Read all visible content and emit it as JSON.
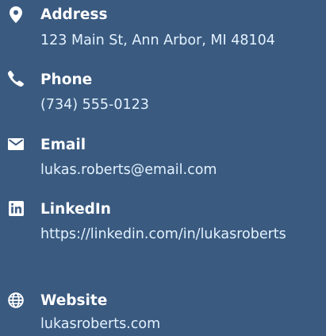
{
  "contacts": [
    {
      "label": "Address",
      "value": "123 Main St, Ann Arbor, MI 48104",
      "icon": "map-pin-icon"
    },
    {
      "label": "Phone",
      "value": "(734) 555-0123",
      "icon": "phone-icon"
    },
    {
      "label": "Email",
      "value": "lukas.roberts@email.com",
      "icon": "envelope-icon"
    },
    {
      "label": "LinkedIn",
      "value": "https://linkedin.com/in/lukasroberts",
      "icon": "linkedin-icon"
    },
    {
      "label": "Website",
      "value": "lukasroberts.com",
      "icon": "globe-icon"
    }
  ],
  "colors": {
    "background": "#3a5a80",
    "label": "#ffffff",
    "value": "#e3f2fe"
  }
}
